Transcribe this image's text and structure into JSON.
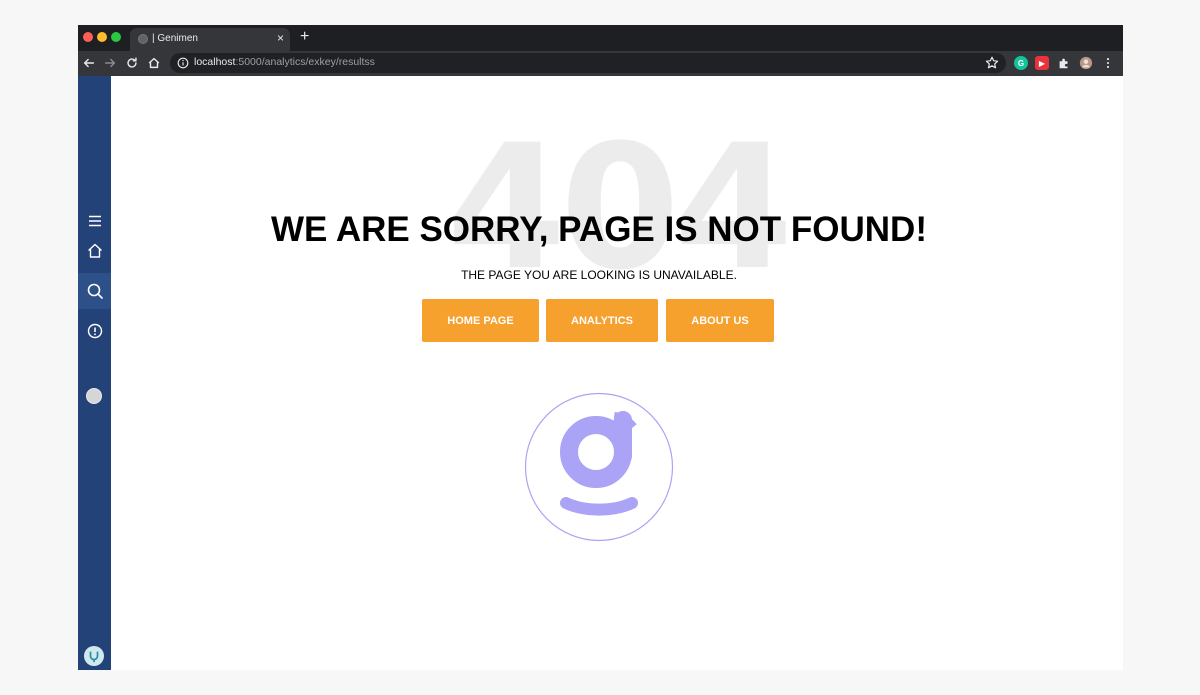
{
  "browser": {
    "tab": {
      "title": "| Genimen",
      "close_glyph": "×"
    },
    "new_tab_glyph": "+",
    "address": {
      "host": "localhost",
      "rest": ":5000/analytics/exkey/resultss"
    },
    "extensions": [
      {
        "name": "grammarly-icon",
        "color": "#15c39a",
        "glyph": "G"
      },
      {
        "name": "screencast-icon",
        "color": "#e8323c",
        "glyph": "▶"
      }
    ]
  },
  "sidebar": {
    "items": [
      "menu-icon",
      "home-icon",
      "search-icon",
      "info-icon"
    ],
    "active_item": "search-icon",
    "colors": {
      "background": "#234378",
      "active": "#2d5089"
    }
  },
  "error": {
    "code": "404",
    "title": "WE ARE SORRY, PAGE IS NOT FOUND!",
    "subtitle": "THE PAGE YOU ARE LOOKING IS UNAVAILABLE."
  },
  "buttons": {
    "home": "HOME PAGE",
    "analytics": "ANALYTICS",
    "about": "ABOUT US"
  },
  "colors": {
    "button": "#f6a02d",
    "logo": "#aaa3f6"
  }
}
